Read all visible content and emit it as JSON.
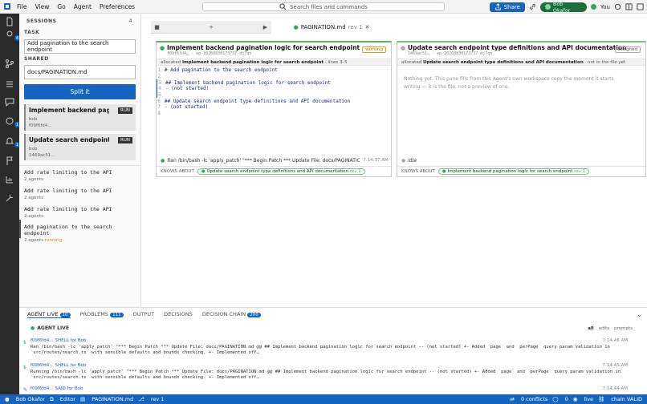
{
  "menubar": {
    "items": [
      "File",
      "View",
      "Go",
      "Agent",
      "Preferences"
    ],
    "search_placeholder": "Search files and commands",
    "share_label": "Share",
    "user_name": "Bob Okafor",
    "you_label": "You"
  },
  "activity_badges": {
    "agents": "4",
    "chat": "1",
    "notifications": "1"
  },
  "sidebar": {
    "sessions_title": "SESSIONS",
    "sessions_count": "4",
    "task_title": "TASK",
    "task_value": "Add pagination to the search endpoint",
    "shared_title": "SHARED",
    "shared_value": "docs/PAGINATION.md",
    "split_button": "Split it",
    "cards": [
      {
        "title": "Implement backend pagination logic for search endpoint",
        "user": "bob",
        "id": "f09f6fd4…",
        "run": "RUN"
      },
      {
        "title": "Update search endpoint type definitions and API documentation",
        "user": "bob",
        "id": "1469ac51…",
        "run": "RUN"
      }
    ],
    "history": [
      {
        "title": "Add rate limiting to the API",
        "agents": "2 agents",
        "status": ""
      },
      {
        "title": "Add rate limiting to the API",
        "agents": "2 agents",
        "status": ""
      },
      {
        "title": "Add rate limiting to the API",
        "agents": "2 agents",
        "status": ""
      },
      {
        "title": "Add pagination to the search endpoint",
        "agents": "2 agents",
        "status": "running"
      }
    ]
  },
  "editor": {
    "tab_file": "PAGINATION.md",
    "tab_rev": "rev 1"
  },
  "pane_a": {
    "title": "Implement backend pagination logic for search endpoint",
    "meta": "f09f6fd4… · ep-20260830173737-dj7qn",
    "tag": "working",
    "alloc_prefix": "allocated",
    "alloc_title": "Implement backend pagination logic for search endpoint",
    "alloc_suffix": "· lines 3–5",
    "lines": [
      {
        "n": "1",
        "t": "# Add pagination to the search endpoint"
      },
      {
        "n": "2",
        "t": ""
      },
      {
        "n": "3",
        "t": "## Implement backend pagination logic for search endpoint"
      },
      {
        "n": "4",
        "t": "- (not started)"
      },
      {
        "n": "5",
        "t": ""
      },
      {
        "n": "6",
        "t": "## Update search endpoint type definitions and API documentation"
      },
      {
        "n": "7",
        "t": "- (not started)"
      },
      {
        "n": "8",
        "t": ""
      }
    ],
    "footer": "Ran /bin/bash -lc 'apply_patch' \"*** Begin Patch *** Update File: docs/PAGINATION.md @@ #",
    "footer_time": "7:14:37 AM",
    "knows": "KNOWS ABOUT",
    "knows_chip": "Update search endpoint type definitions and API documentation",
    "knows_rev": "rev 1"
  },
  "pane_b": {
    "title": "Update search endpoint type definitions and API documentation",
    "meta": "1469ac51… · ep-20260830173737-dj7qn",
    "tag": "assigned",
    "alloc_prefix": "allocated",
    "alloc_title": "Update search endpoint type definitions and API documentation",
    "alloc_suffix": "· not in the file yet",
    "body": "Nothing yet. This pane fills from this Agent's own workspace copy the moment it starts writing — it is the file, not a preview of one.",
    "footer": "idle",
    "knows": "KNOWS ABOUT",
    "knows_chip": "Implement backend pagination logic for search endpoint",
    "knows_rev": "rev 1"
  },
  "bottom": {
    "tabs": [
      {
        "label": "AGENT LIVE",
        "count": "10"
      },
      {
        "label": "PROBLEMS",
        "count": "111"
      },
      {
        "label": "OUTPUT",
        "count": ""
      },
      {
        "label": "DECISIONS",
        "count": ""
      },
      {
        "label": "DECISION CHAIN",
        "count": "200"
      }
    ],
    "live_title": "AGENT LIVE",
    "filters": [
      "all",
      "edits",
      "prompts"
    ],
    "entries": [
      {
        "head": "f09f6fd4… SHELL for Bob",
        "line1": "Ran /bin/bash -lc 'apply_patch' \"*** Begin Patch *** Update File: docs/PAGINATION.md @@ ## Implement backend pagination logic for search endpoint -- (not started) +- Added `page` and `perPage` query param validation in",
        "line2": "`src/routes/search.ts` with sensible defaults and bounds checking. +- Implemented off…",
        "time": "7:14:46 AM"
      },
      {
        "head": "f09f6fd4… SHELL for Bob",
        "line1": "Running /bin/bash -lc 'apply_patch' \"*** Begin Patch *** Update File: docs/PAGINATION.md @@ ## Implement backend pagination logic for search endpoint -- (not started) +- Added `page` and `perPage` query param validation in",
        "line2": "`src/routes/search.ts` with sensible defaults and bounds checking. +- Implemented off…",
        "time": "7:14:45 AM"
      },
      {
        "head": "f09f6fd4… SAID for Bob",
        "line1": "",
        "line2": "",
        "time": "7:14:44 AM"
      }
    ]
  },
  "status": {
    "user": "Bob Okafor",
    "mode": "Editor",
    "file": "PAGINATION.md",
    "rev": "rev 1",
    "conflicts": "0 conflicts",
    "issues": "0",
    "live": "live",
    "chain": "chain VALID"
  }
}
